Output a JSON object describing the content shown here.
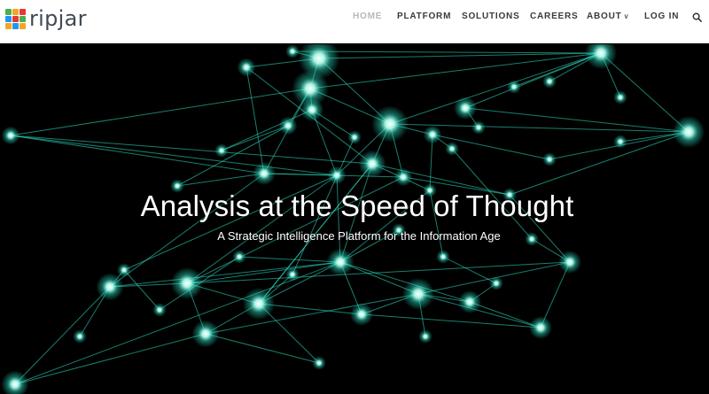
{
  "brand": {
    "name": "ripjar",
    "logo_colors": [
      "#4cae4f",
      "#f5a623",
      "#e53935",
      "#2196f3",
      "#e53935",
      "#4cae4f",
      "#f5a623",
      "#2196f3",
      "#f5a623"
    ]
  },
  "nav": {
    "items": [
      {
        "label": "HOME",
        "active": true
      },
      {
        "label": "PLATFORM",
        "active": false
      },
      {
        "label": "SOLUTIONS",
        "active": false
      },
      {
        "label": "CAREERS",
        "active": false
      },
      {
        "label": "ABOUT",
        "active": false,
        "has_dropdown": true
      },
      {
        "label": "LOG IN",
        "active": false
      }
    ],
    "search_icon": "search-icon"
  },
  "hero": {
    "title": "Analysis at the Speed of Thought",
    "subtitle": "A Strategic Intelligence Platform for the Information Age",
    "background": "network-graph",
    "accent_color": "#2ee6c8"
  }
}
